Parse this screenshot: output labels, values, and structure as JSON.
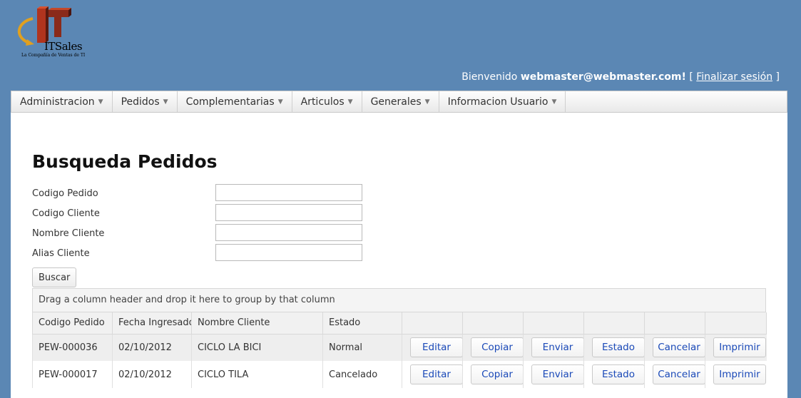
{
  "logo": {
    "text": "ITSales",
    "tagline": "La Compañía de Ventas de TI"
  },
  "header": {
    "welcome_prefix": "Bienvenido",
    "user": "webmaster@webmaster.com!",
    "bracket_open": "[",
    "logout_label": "Finalizar sesión",
    "bracket_close": "]"
  },
  "menu": {
    "items": [
      {
        "label": "Administracion"
      },
      {
        "label": "Pedidos"
      },
      {
        "label": "Complementarias"
      },
      {
        "label": "Articulos"
      },
      {
        "label": "Generales"
      },
      {
        "label": "Informacion Usuario"
      }
    ]
  },
  "page": {
    "title": "Busqueda Pedidos"
  },
  "form": {
    "codigo_pedido": {
      "label": "Codigo Pedido",
      "value": ""
    },
    "codigo_cliente": {
      "label": "Codigo Cliente",
      "value": ""
    },
    "nombre_cliente": {
      "label": "Nombre Cliente",
      "value": ""
    },
    "alias_cliente": {
      "label": "Alias Cliente",
      "value": ""
    },
    "search_label": "Buscar"
  },
  "grid": {
    "group_hint": "Drag a column header and drop it here to group by that column",
    "columns": [
      "Codigo Pedido",
      "Fecha Ingresado",
      "Nombre Cliente",
      "Estado",
      "",
      "",
      "",
      "",
      "",
      ""
    ],
    "action_labels": {
      "editar": "Editar",
      "copiar": "Copiar",
      "enviar": "Enviar",
      "estado": "Estado",
      "cancelar": "Cancelar",
      "imprimir": "Imprimir"
    },
    "rows": [
      {
        "codigo": "PEW-000036",
        "fecha": "02/10/2012",
        "cliente": "CICLO LA BICI",
        "estado": "Normal"
      },
      {
        "codigo": "PEW-000017",
        "fecha": "02/10/2012",
        "cliente": "CICLO TILA",
        "estado": "Cancelado"
      }
    ]
  },
  "colors": {
    "background": "#5b87b4",
    "link": "#1a49b8",
    "row_alt": "#eeeeee"
  }
}
